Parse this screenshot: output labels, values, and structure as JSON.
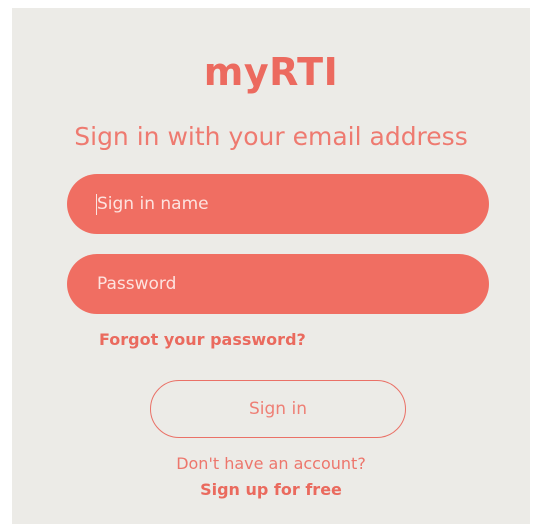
{
  "app": {
    "title": "myRTI",
    "subtitle": "Sign in with your email address"
  },
  "form": {
    "username": {
      "value": "",
      "placeholder": "Sign in name"
    },
    "password": {
      "value": "",
      "placeholder": "Password"
    },
    "forgot_link": "Forgot your password?",
    "signin_button": "Sign in"
  },
  "signup": {
    "prompt": "Don't have an account?",
    "link": "Sign up for free"
  },
  "colors": {
    "accent": "#f06e62",
    "background": "#ecebe7",
    "text_accent": "#ea6a5e"
  }
}
